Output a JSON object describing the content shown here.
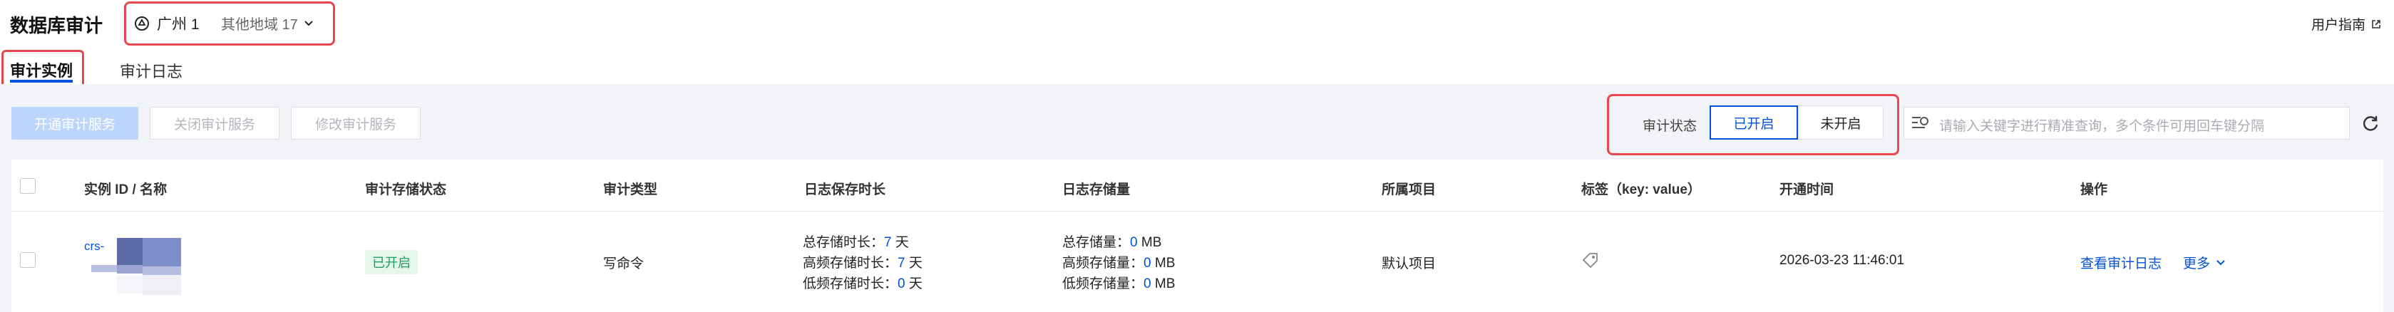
{
  "header": {
    "title": "数据库审计",
    "region": "广州 1",
    "other_regions": "其他地域 17",
    "user_guide": "用户指南"
  },
  "tabs": [
    {
      "label": "审计实例"
    },
    {
      "label": "审计日志"
    }
  ],
  "toolbar": {
    "enable_btn": "开通审计服务",
    "disable_btn": "关闭审计服务",
    "modify_btn": "修改审计服务",
    "status_label": "审计状态",
    "status_on": "已开启",
    "status_off": "未开启",
    "search_placeholder": "请输入关键字进行精准查询，多个条件可用回车键分隔"
  },
  "table": {
    "columns": [
      "实例 ID / 名称",
      "审计存储状态",
      "审计类型",
      "日志保存时长",
      "日志存储量",
      "所属项目",
      "标签（key: value）",
      "开通时间",
      "操作"
    ],
    "rows": [
      {
        "instance_id": "crs-",
        "storage_status": "已开启",
        "audit_type": "写命令",
        "total_retention_label": "总存储时长：",
        "total_retention_value": "7",
        "high_retention_label": "高频存储时长：",
        "high_retention_value": "7",
        "low_retention_label": "低频存储时长：",
        "low_retention_value": "0",
        "retention_unit": "天",
        "total_storage_label": "总存储量：",
        "total_storage_value": "0",
        "high_storage_label": "高频存储量：",
        "high_storage_value": "0",
        "low_storage_label": "低频存储量：",
        "low_storage_value": "0",
        "storage_unit": "MB",
        "project": "默认项目",
        "open_time": "2026-03-23 11:46:01",
        "action_view": "查看审计日志",
        "action_more": "更多"
      }
    ]
  },
  "colors": {
    "accent": "#0052d9",
    "highlight": "#e8474f",
    "success": "#1e9f5b"
  }
}
